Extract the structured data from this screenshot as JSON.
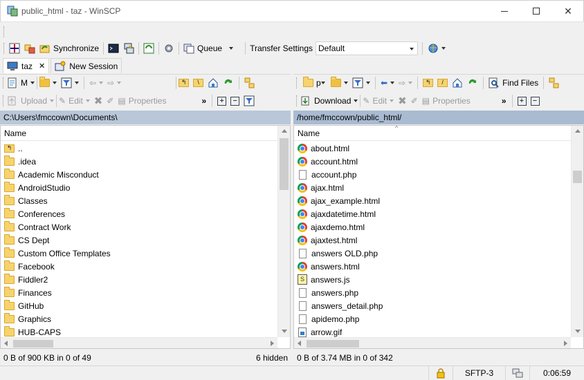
{
  "window": {
    "title": "public_html - taz - WinSCP"
  },
  "toolbar_main": {
    "synchronize": "Synchronize",
    "queue": "Queue",
    "transfer_settings_label": "Transfer Settings",
    "transfer_settings_value": "Default"
  },
  "tabs": [
    {
      "label": "taz"
    },
    {
      "label": "New Session"
    }
  ],
  "left_toolbar": {
    "drive": "M",
    "upload": "Upload",
    "edit": "Edit",
    "properties": "Properties"
  },
  "right_toolbar": {
    "drive": "p",
    "find_files": "Find Files",
    "download": "Download",
    "edit": "Edit",
    "properties": "Properties"
  },
  "left_panel": {
    "path": "C:\\Users\\fmccown\\Documents\\",
    "column_name": "Name",
    "items": [
      "..",
      ".idea",
      "Academic Misconduct",
      "AndroidStudio",
      "Classes",
      "Conferences",
      "Contract Work",
      "CS Dept",
      "Custom Office Templates",
      "Facebook",
      "Fiddler2",
      "Finances",
      "GitHub",
      "Graphics",
      "HUB-CAPS"
    ],
    "status_left": "0 B of 900 KB in 0 of 49",
    "status_right": "6 hidden"
  },
  "right_panel": {
    "path": "/home/fmccown/public_html/",
    "column_name": "Name",
    "items": [
      {
        "name": "about.html",
        "icon": "chrome"
      },
      {
        "name": "account.html",
        "icon": "chrome"
      },
      {
        "name": "account.php",
        "icon": "doc"
      },
      {
        "name": "ajax.html",
        "icon": "chrome"
      },
      {
        "name": "ajax_example.html",
        "icon": "chrome"
      },
      {
        "name": "ajaxdatetime.html",
        "icon": "chrome"
      },
      {
        "name": "ajaxdemo.html",
        "icon": "chrome"
      },
      {
        "name": "ajaxtest.html",
        "icon": "chrome"
      },
      {
        "name": "answers OLD.php",
        "icon": "doc"
      },
      {
        "name": "answers.html",
        "icon": "chrome"
      },
      {
        "name": "answers.js",
        "icon": "js"
      },
      {
        "name": "answers.php",
        "icon": "doc"
      },
      {
        "name": "answers_detail.php",
        "icon": "doc"
      },
      {
        "name": "apidemo.php",
        "icon": "doc"
      },
      {
        "name": "arrow.gif",
        "icon": "gif"
      }
    ],
    "status_left": "0 B of 3.74 MB in 0 of 342"
  },
  "statusbar": {
    "protocol": "SFTP-3",
    "time": "0:06:59"
  }
}
